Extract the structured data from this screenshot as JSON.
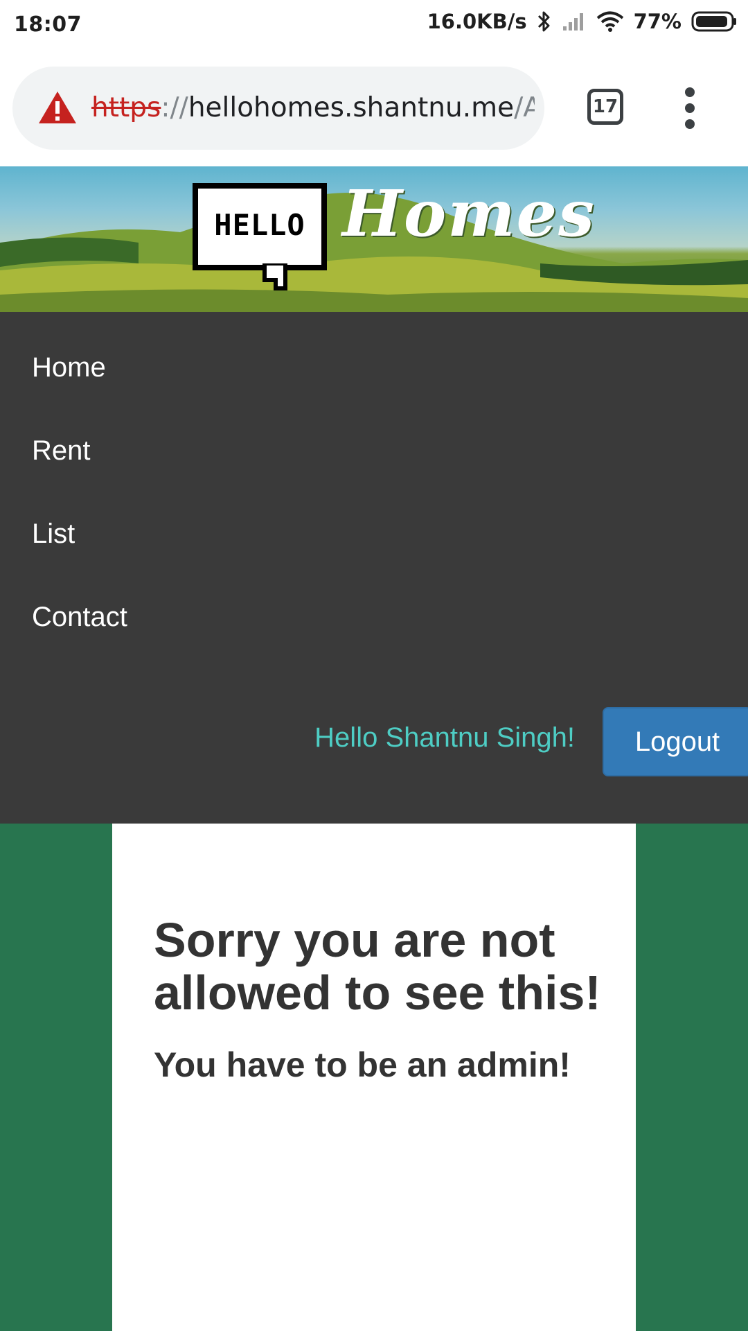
{
  "status_bar": {
    "time": "18:07",
    "network_speed": "16.0KB/s",
    "battery": "77%",
    "icons": [
      "bluetooth-icon",
      "cell-signal-icon",
      "wifi-icon",
      "battery-icon"
    ]
  },
  "browser": {
    "url_scheme": "https",
    "url_separator": "://",
    "url_host": "hellohomes.shantnu.me",
    "url_path": "/Ad",
    "tab_count": "17",
    "security_icon": "warning-icon",
    "menu_icon": "more-vert-icon"
  },
  "header": {
    "logo_bubble_text": "HELLO",
    "logo_word": "Homes"
  },
  "nav": {
    "items": [
      {
        "label": "Home"
      },
      {
        "label": "Rent"
      },
      {
        "label": "List"
      },
      {
        "label": "Contact"
      }
    ],
    "greeting": "Hello Shantnu Singh!",
    "logout_label": "Logout"
  },
  "content": {
    "heading": "Sorry you are not allowed to see this!",
    "subheading": "You have to be an admin!"
  },
  "colors": {
    "nav_bg": "#3a3a3a",
    "greeting": "#4ecdc4",
    "button": "#337ab7",
    "page_bg": "#28754f",
    "warning": "#c5221f"
  }
}
